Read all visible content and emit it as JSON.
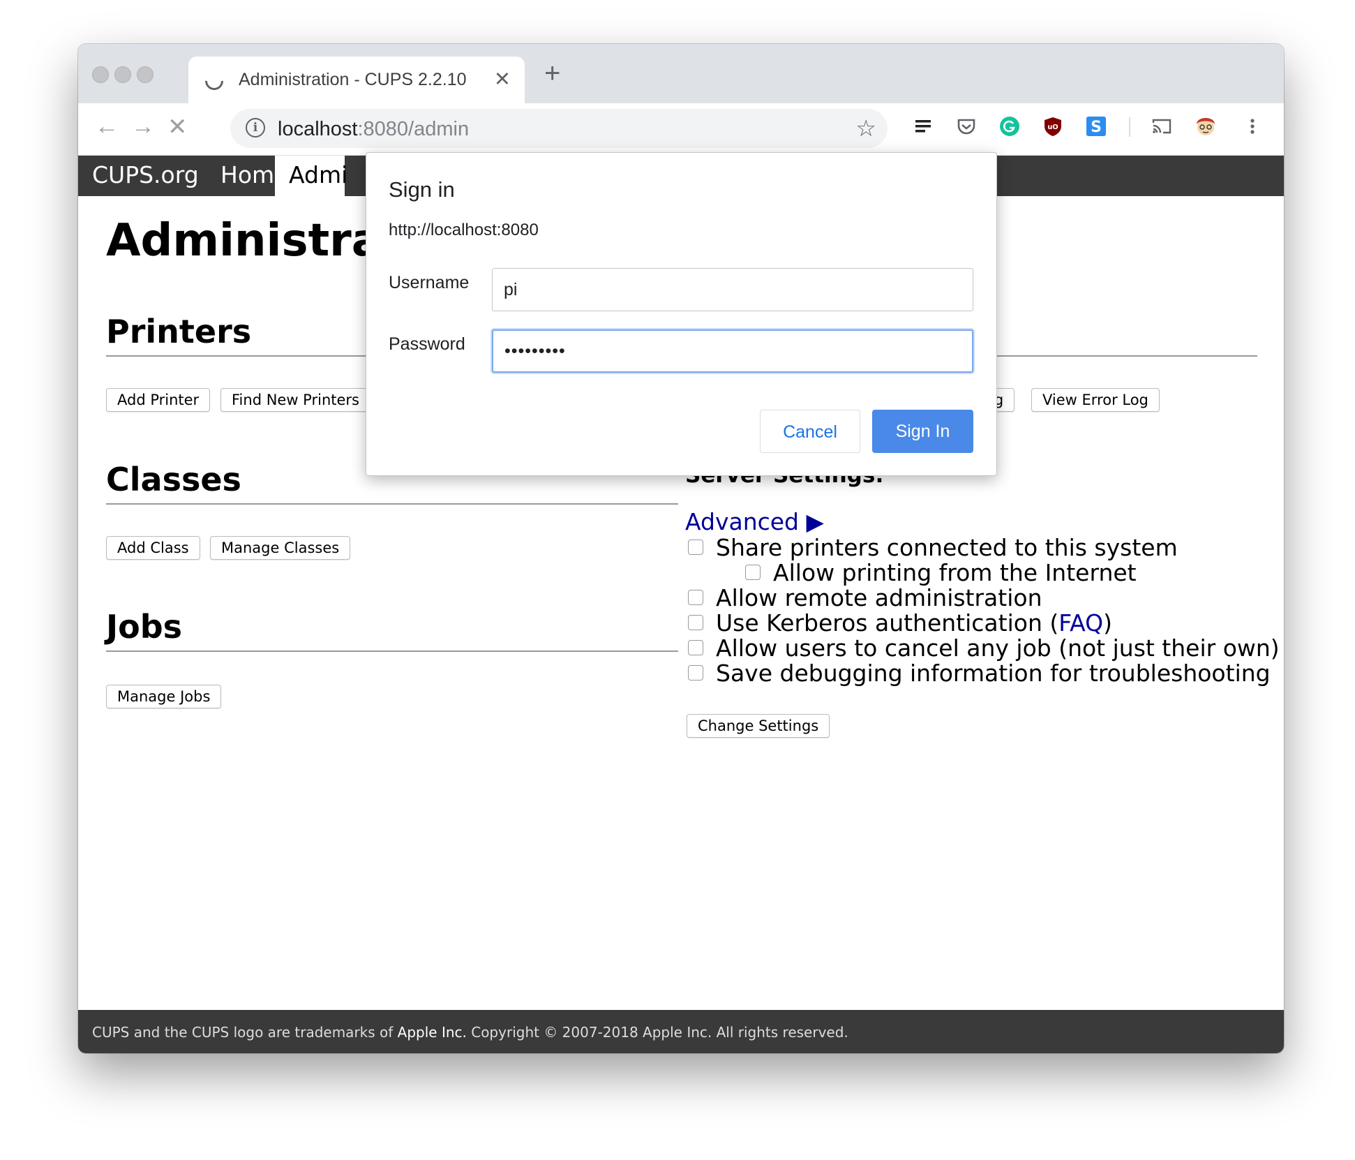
{
  "browser": {
    "tab_title": "Administration - CUPS 2.2.10",
    "tab_close": "✕",
    "new_tab": "+",
    "url_host": "localhost",
    "url_path": ":8080/admin",
    "icons": [
      "back-icon",
      "forward-icon",
      "stop-icon",
      "info-icon",
      "star-icon",
      "reading-list-icon",
      "pocket-icon",
      "grammarly-icon",
      "ublock-icon",
      "s-extension-icon",
      "cast-icon",
      "profile-avatar",
      "menu-icon"
    ]
  },
  "nav": {
    "cups_org": "CUPS.org",
    "home": "Home",
    "admin": "Admi"
  },
  "page": {
    "title": "Administrat",
    "printers_heading": "Printers",
    "add_printer": "Add Printer",
    "find_new_printers": "Find New Printers",
    "access_log_partial": "og",
    "view_error_log": "View Error Log",
    "classes_heading": "Classes",
    "add_class": "Add Class",
    "manage_classes": "Manage Classes",
    "jobs_heading": "Jobs",
    "manage_jobs": "Manage Jobs",
    "server_settings": "Server Settings:",
    "advanced": "Advanced ▶",
    "settings": [
      "Share printers connected to this system",
      "Allow printing from the Internet",
      "Allow remote administration",
      "Use Kerberos authentication (",
      "Allow users to cancel any job (not just their own)",
      "Save debugging information for troubleshooting"
    ],
    "faq": "FAQ",
    "faq_close": ")",
    "change_settings": "Change Settings"
  },
  "footer": {
    "text1": "CUPS and the CUPS logo are trademarks of ",
    "apple": "Apple Inc.",
    "text2": " Copyright © 2007-2018 Apple Inc. All rights reserved."
  },
  "dialog": {
    "title": "Sign in",
    "origin": "http://localhost:8080",
    "username_label": "Username",
    "username_value": "pi",
    "password_label": "Password",
    "password_value": "•••••••••",
    "cancel": "Cancel",
    "sign_in": "Sign In"
  },
  "colors": {
    "accent_blue": "#4a89e8",
    "link_blue": "#000099",
    "cups_bar": "#3a3a3a"
  }
}
